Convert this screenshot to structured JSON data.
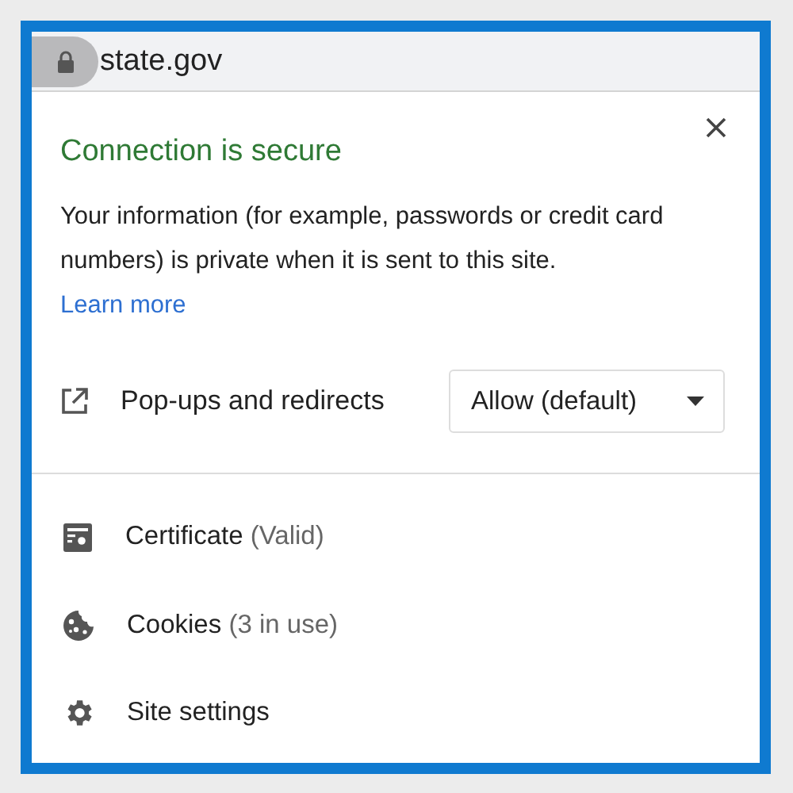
{
  "address_bar": {
    "url": "state.gov"
  },
  "panel": {
    "title": "Connection is secure",
    "description": "Your information (for example, passwords or credit card numbers) is private when it is sent to this site.",
    "link": "Learn more",
    "permission": {
      "label": "Pop-ups and redirects",
      "value": "Allow (default)"
    },
    "items": [
      {
        "kind": "certificate",
        "label": "Certificate",
        "detail": "(Valid)"
      },
      {
        "kind": "cookies",
        "label": "Cookies",
        "detail": "(3 in use)"
      },
      {
        "kind": "settings",
        "label": "Site settings"
      }
    ]
  }
}
